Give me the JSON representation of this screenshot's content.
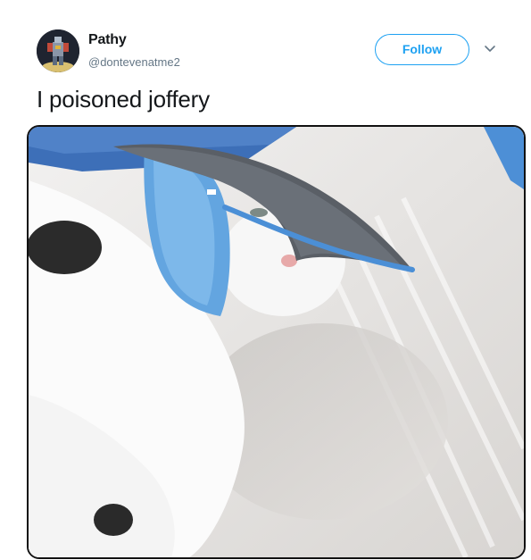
{
  "user": {
    "display_name": "Pathy",
    "handle": "@dontevenatme2",
    "avatar_icon": "avatar-icon"
  },
  "actions": {
    "follow_label": "Follow",
    "menu_icon": "chevron-down-icon"
  },
  "tweet": {
    "text": "I poisoned joffery"
  },
  "media": {
    "description_icon": "photo-icon"
  },
  "colors": {
    "accent": "#1da1f2",
    "secondary_text": "#657786",
    "primary_text": "#14171a"
  }
}
